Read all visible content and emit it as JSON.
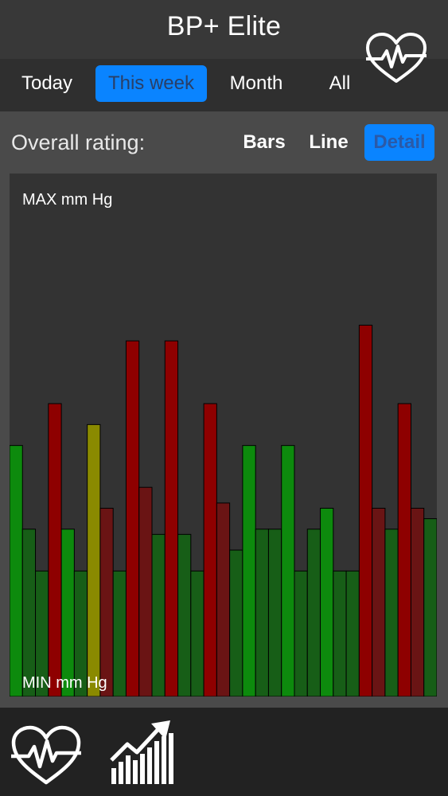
{
  "header": {
    "title": "BP+ Elite"
  },
  "tabs": [
    {
      "label": "Today",
      "selected": false
    },
    {
      "label": "This week",
      "selected": true
    },
    {
      "label": "Month",
      "selected": false
    },
    {
      "label": "All",
      "selected": false
    }
  ],
  "rating": {
    "label": "Overall rating:"
  },
  "view_modes": [
    {
      "label": "Bars",
      "selected": false
    },
    {
      "label": "Line",
      "selected": false
    },
    {
      "label": "Detail",
      "selected": true
    }
  ],
  "chart_labels": {
    "max": "MAX mm Hg",
    "min": "MIN mm Hg"
  },
  "colors": {
    "accent": "#0a84ff",
    "green": "#0d8a0d",
    "dark_green": "#175e17",
    "red": "#8e0000",
    "dark_red": "#6a1414",
    "yellow": "#8a8a00"
  },
  "icons": {
    "header_right": "heart-pulse-icon",
    "bottom_left": "heart-pulse-icon",
    "bottom_right": "stats-chart-icon"
  },
  "chart_data": {
    "type": "bar",
    "title": "",
    "ylim": [
      0,
      1
    ],
    "yaxis_top_label": "MAX mm Hg",
    "yaxis_bottom_label": "MIN mm Hg",
    "bars": [
      {
        "value": 0.48,
        "color": "green"
      },
      {
        "value": 0.32,
        "color": "dark_green"
      },
      {
        "value": 0.24,
        "color": "dark_green"
      },
      {
        "value": 0.56,
        "color": "red"
      },
      {
        "value": 0.32,
        "color": "green"
      },
      {
        "value": 0.24,
        "color": "dark_green"
      },
      {
        "value": 0.52,
        "color": "yellow"
      },
      {
        "value": 0.36,
        "color": "dark_red"
      },
      {
        "value": 0.24,
        "color": "dark_green"
      },
      {
        "value": 0.68,
        "color": "red"
      },
      {
        "value": 0.4,
        "color": "dark_red"
      },
      {
        "value": 0.31,
        "color": "dark_green"
      },
      {
        "value": 0.68,
        "color": "red"
      },
      {
        "value": 0.31,
        "color": "dark_green"
      },
      {
        "value": 0.24,
        "color": "dark_green"
      },
      {
        "value": 0.56,
        "color": "red"
      },
      {
        "value": 0.37,
        "color": "dark_red"
      },
      {
        "value": 0.28,
        "color": "dark_green"
      },
      {
        "value": 0.48,
        "color": "green"
      },
      {
        "value": 0.32,
        "color": "dark_green"
      },
      {
        "value": 0.32,
        "color": "dark_green"
      },
      {
        "value": 0.48,
        "color": "green"
      },
      {
        "value": 0.24,
        "color": "dark_green"
      },
      {
        "value": 0.32,
        "color": "dark_green"
      },
      {
        "value": 0.36,
        "color": "green"
      },
      {
        "value": 0.24,
        "color": "dark_green"
      },
      {
        "value": 0.24,
        "color": "dark_green"
      },
      {
        "value": 0.71,
        "color": "red"
      },
      {
        "value": 0.36,
        "color": "dark_red"
      },
      {
        "value": 0.32,
        "color": "dark_green"
      },
      {
        "value": 0.56,
        "color": "red"
      },
      {
        "value": 0.36,
        "color": "dark_red"
      },
      {
        "value": 0.34,
        "color": "dark_green"
      }
    ]
  }
}
